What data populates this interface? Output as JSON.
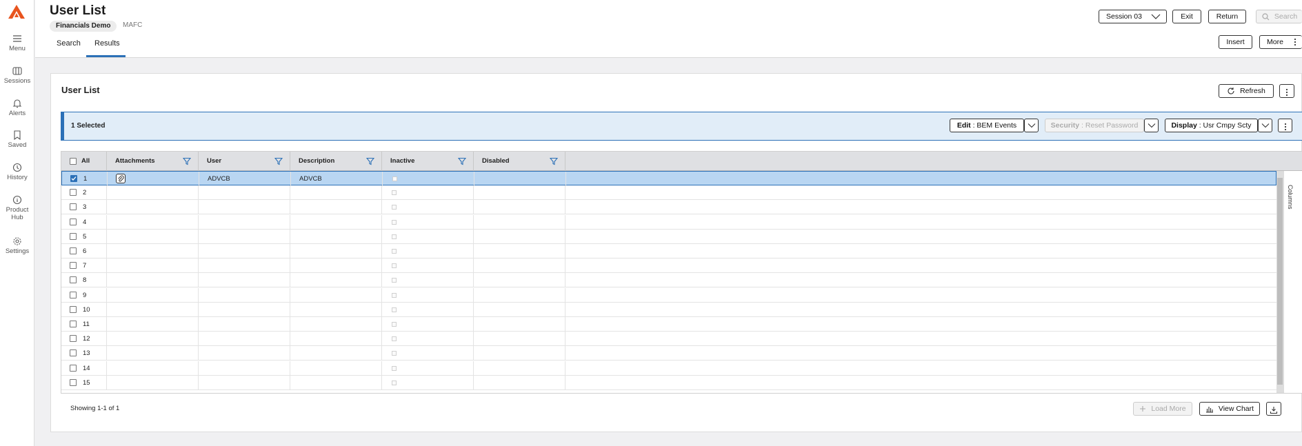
{
  "nav": {
    "items": [
      {
        "label": "Menu",
        "icon": "menu-icon"
      },
      {
        "label": "Sessions",
        "icon": "sessions-icon"
      },
      {
        "label": "Alerts",
        "icon": "bell-icon"
      },
      {
        "label": "Saved",
        "icon": "bookmark-icon"
      },
      {
        "label": "History",
        "icon": "clock-icon"
      },
      {
        "label": "Product Hub",
        "icon": "info-icon"
      },
      {
        "label": "Settings",
        "icon": "gear-icon"
      }
    ]
  },
  "header": {
    "title": "User List",
    "chip": "Financials Demo",
    "company": "MAFC",
    "tabs": [
      "Search",
      "Results"
    ],
    "active_tab": "Results",
    "session": "Session 03",
    "exit": "Exit",
    "return": "Return",
    "search": "Search",
    "insert": "Insert",
    "more": "More"
  },
  "card": {
    "title": "User List",
    "refresh": "Refresh",
    "selected_text": "1 Selected",
    "action_edit_bold": "Edit",
    "action_edit_rest": " : BEM Events",
    "action_security_bold": "Security",
    "action_security_rest": " : Reset Password",
    "action_display_bold": "Display",
    "action_display_rest": " : Usr Cmpy Scty"
  },
  "grid": {
    "columns": [
      "All",
      "Attachments",
      "User",
      "Description",
      "Inactive",
      "Disabled"
    ],
    "rows": [
      {
        "num": "1",
        "user": "ADVCB",
        "description": "ADVCB",
        "selected": true
      },
      {
        "num": "2",
        "user": "",
        "description": "",
        "selected": false
      },
      {
        "num": "3",
        "user": "",
        "description": "",
        "selected": false
      },
      {
        "num": "4",
        "user": "",
        "description": "",
        "selected": false
      },
      {
        "num": "5",
        "user": "",
        "description": "",
        "selected": false
      },
      {
        "num": "6",
        "user": "",
        "description": "",
        "selected": false
      },
      {
        "num": "7",
        "user": "",
        "description": "",
        "selected": false
      },
      {
        "num": "8",
        "user": "",
        "description": "",
        "selected": false
      },
      {
        "num": "9",
        "user": "",
        "description": "",
        "selected": false
      },
      {
        "num": "10",
        "user": "",
        "description": "",
        "selected": false
      },
      {
        "num": "11",
        "user": "",
        "description": "",
        "selected": false
      },
      {
        "num": "12",
        "user": "",
        "description": "",
        "selected": false
      },
      {
        "num": "13",
        "user": "",
        "description": "",
        "selected": false
      },
      {
        "num": "14",
        "user": "",
        "description": "",
        "selected": false
      },
      {
        "num": "15",
        "user": "",
        "description": "",
        "selected": false
      }
    ],
    "columns_panel": "Columns"
  },
  "footer": {
    "showing": "Showing 1-1 of 1",
    "load_more": "Load More",
    "view_chart": "View Chart"
  },
  "colors": {
    "accent": "#2b70b7",
    "logo": "#e8541e",
    "selection_bg": "#b9d6f2"
  }
}
